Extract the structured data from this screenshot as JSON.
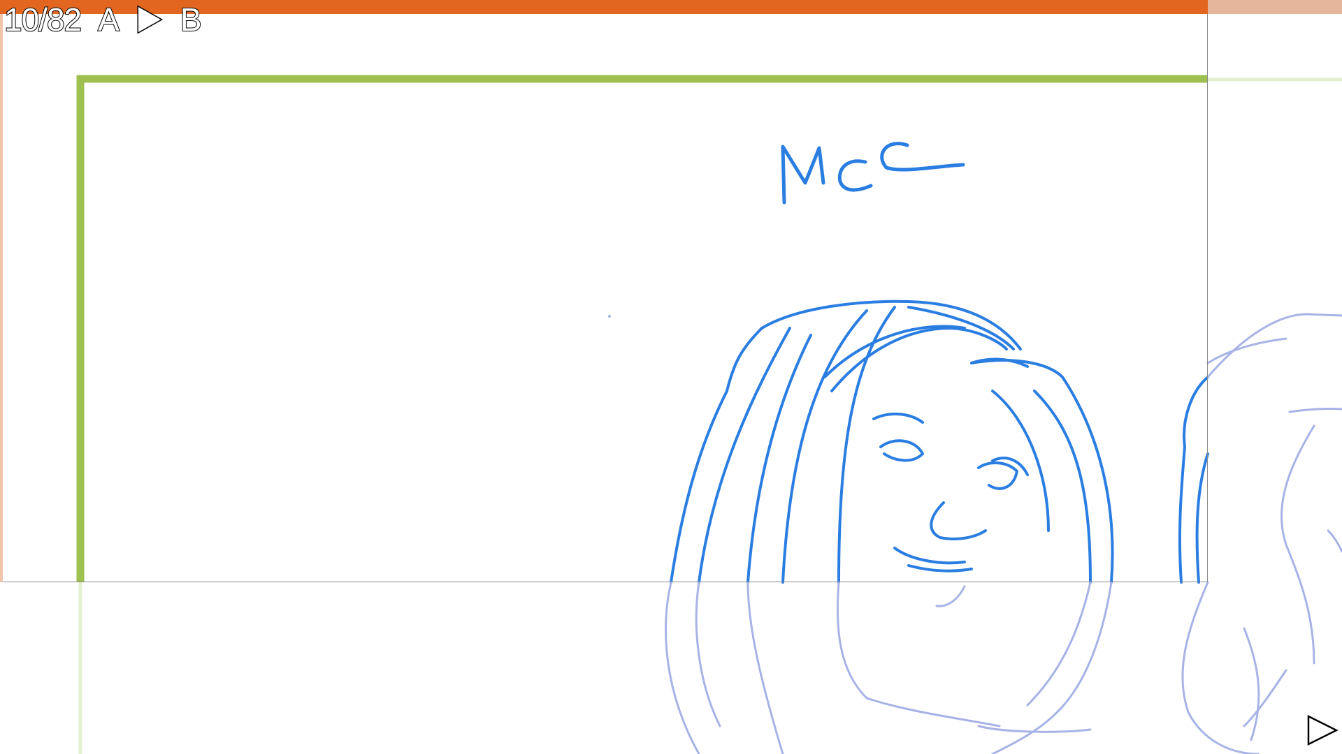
{
  "timeline": {
    "panel_counter": "10/82",
    "from_label": "A",
    "play_icon": "play-arrow-icon",
    "to_label": "B"
  },
  "canvas": {
    "sketch_text": "MCL",
    "frame_color": "#9dc04f",
    "sketch_color": "#2a7de1",
    "timeline_color": "#e2661f"
  },
  "controls": {
    "next_icon": "play-arrow-icon"
  }
}
